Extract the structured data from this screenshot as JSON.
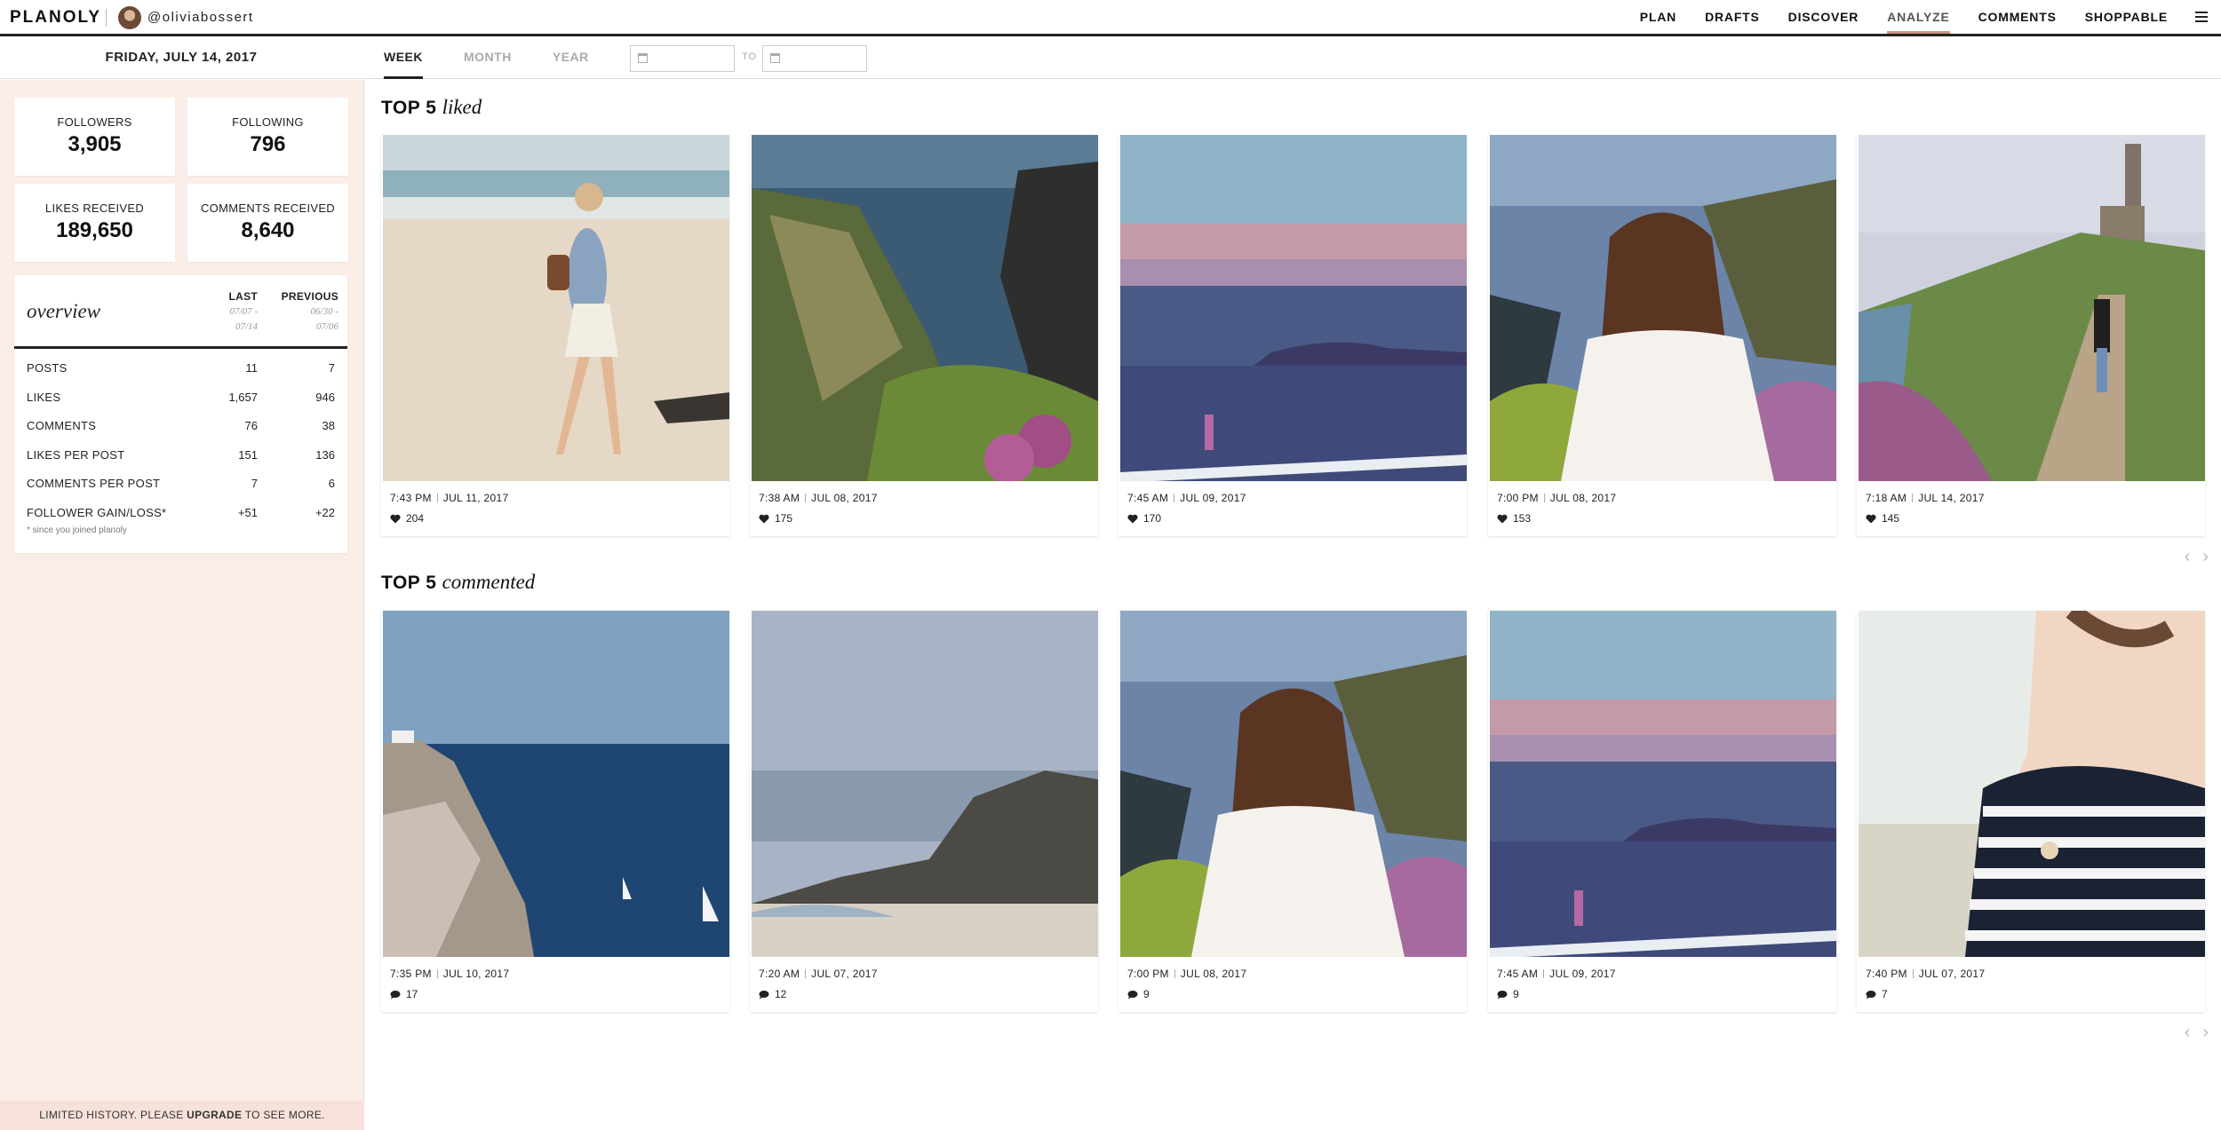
{
  "header": {
    "logo": "PLANOLY",
    "username": "@oliviabossert",
    "nav": [
      {
        "label": "PLAN",
        "active": false
      },
      {
        "label": "DRAFTS",
        "active": false
      },
      {
        "label": "DISCOVER",
        "active": false
      },
      {
        "label": "ANALYZE",
        "active": true
      },
      {
        "label": "COMMENTS",
        "active": false
      },
      {
        "label": "SHOPPABLE",
        "active": false
      }
    ],
    "accent_color": "#c9947c"
  },
  "subbar": {
    "date": "FRIDAY, JULY 14, 2017",
    "tabs": [
      "WEEK",
      "MONTH",
      "YEAR"
    ],
    "active_tab": "WEEK",
    "from_value": "",
    "to_label": "TO",
    "to_value": ""
  },
  "stats": {
    "followers_label": "FOLLOWERS",
    "followers": "3,905",
    "following_label": "FOLLOWING",
    "following": "796",
    "likes_label": "LIKES RECEIVED",
    "likes": "189,650",
    "comments_label": "COMMENTS RECEIVED",
    "comments": "8,640"
  },
  "overview": {
    "title": "overview",
    "col_last": "LAST",
    "col_last_range_1": "07/07 -",
    "col_last_range_2": "07/14",
    "col_prev": "PREVIOUS",
    "col_prev_range_1": "06/30 -",
    "col_prev_range_2": "07/06",
    "rows": [
      {
        "label": "POSTS",
        "last": "11",
        "previous": "7"
      },
      {
        "label": "LIKES",
        "last": "1,657",
        "previous": "946"
      },
      {
        "label": "COMMENTS",
        "last": "76",
        "previous": "38"
      },
      {
        "label": "LIKES PER POST",
        "last": "151",
        "previous": "136"
      },
      {
        "label": "COMMENTS PER POST",
        "last": "7",
        "previous": "6"
      },
      {
        "label": "FOLLOWER GAIN/LOSS*",
        "last": "+51",
        "previous": "+22"
      }
    ],
    "note": "* since you joined planoly"
  },
  "upgrade": {
    "prefix": "LIMITED HISTORY. PLEASE ",
    "link": "UPGRADE",
    "suffix": " TO SEE MORE."
  },
  "top_liked": {
    "title_strong": "TOP 5",
    "title_italic": "liked",
    "posts": [
      {
        "time": "7:43 PM",
        "date": "JUL 11, 2017",
        "count": "204",
        "scene": "beach-walk"
      },
      {
        "time": "7:38 AM",
        "date": "JUL 08, 2017",
        "count": "175",
        "scene": "cliff-sea"
      },
      {
        "time": "7:45 AM",
        "date": "JUL 09, 2017",
        "count": "170",
        "scene": "sunset-bay"
      },
      {
        "time": "7:00 PM",
        "date": "JUL 08, 2017",
        "count": "153",
        "scene": "girl-cliff"
      },
      {
        "time": "7:18 AM",
        "date": "JUL 14, 2017",
        "count": "145",
        "scene": "coast-path"
      }
    ]
  },
  "top_commented": {
    "title_strong": "TOP 5",
    "title_italic": "commented",
    "posts": [
      {
        "time": "7:35 PM",
        "date": "JUL 10, 2017",
        "count": "17",
        "scene": "cliff-sail"
      },
      {
        "time": "7:20 AM",
        "date": "JUL 07, 2017",
        "count": "12",
        "scene": "rocky-beach"
      },
      {
        "time": "7:00 PM",
        "date": "JUL 08, 2017",
        "count": "9",
        "scene": "girl-cliff"
      },
      {
        "time": "7:45 AM",
        "date": "JUL 09, 2017",
        "count": "9",
        "scene": "sunset-bay"
      },
      {
        "time": "7:40 PM",
        "date": "JUL 07, 2017",
        "count": "7",
        "scene": "striped-shirt"
      }
    ]
  }
}
